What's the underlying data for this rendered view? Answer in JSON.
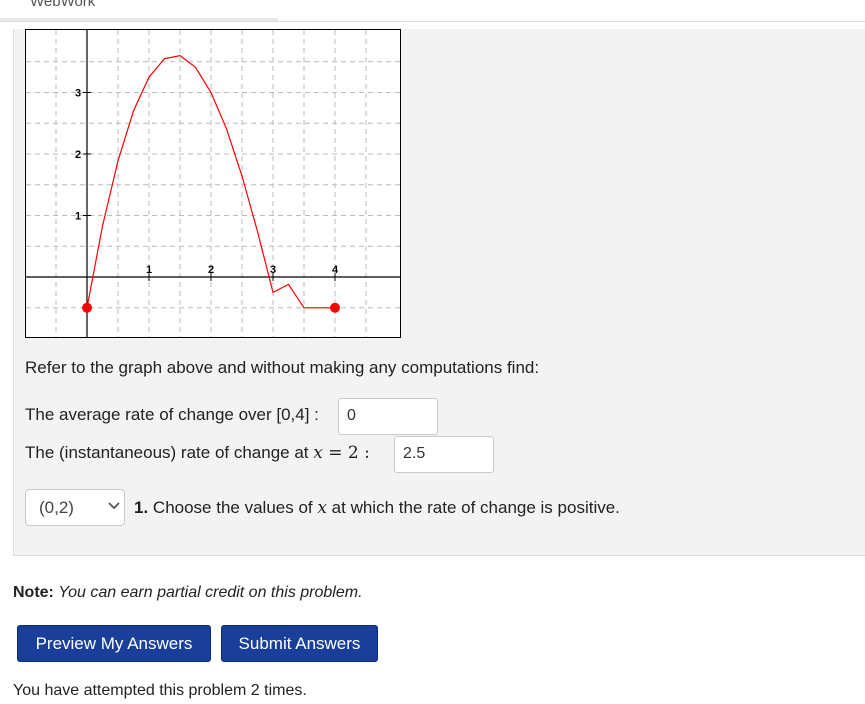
{
  "header": {
    "site_title": "WebWork"
  },
  "graph": {
    "x_tick_labels": [
      "1",
      "2",
      "3",
      "4"
    ],
    "y_tick_labels": [
      "1",
      "2",
      "3"
    ],
    "colors": {
      "curve": "#ff0000",
      "endpoint": "#ff0000",
      "grid": "#bbbbbb",
      "axis": "#000000"
    },
    "chart_data": {
      "type": "line",
      "title": "",
      "xlabel": "",
      "ylabel": "",
      "xlim": [
        -1,
        5
      ],
      "ylim": [
        -1,
        4
      ],
      "grid": true,
      "series": [
        {
          "x": [
            0,
            0.25,
            0.5,
            0.75,
            1,
            1.25,
            1.5,
            1.75,
            2,
            2.25,
            2.5,
            2.75,
            3,
            3.25,
            3.5,
            3.75,
            4
          ],
          "y": [
            -0.5,
            0.83,
            1.89,
            2.7,
            3.25,
            3.55,
            3.6,
            3.41,
            3,
            2.41,
            1.64,
            0.74,
            -0.25,
            -0.12,
            -0.5,
            -0.5,
            -0.5
          ]
        }
      ],
      "endpoints": [
        {
          "x": 0,
          "y": -0.5
        },
        {
          "x": 4,
          "y": -0.5
        }
      ]
    }
  },
  "problem": {
    "instruction": "Refer to the graph above and without making any computations find:",
    "q1_label": "The average rate of change over [0,4] :",
    "q1_answer": "0",
    "q2_label_prefix": "The (instantaneous) rate of change at ",
    "q2_var": "x",
    "q2_eq": " = 2 :",
    "q2_answer": "2.5",
    "select_value": "(0,2)",
    "q3_number": "1.",
    "q3_text_prefix": " Choose the values of ",
    "q3_var": "x",
    "q3_text_suffix": " at which the rate of change is positive."
  },
  "note": {
    "label": "Note:",
    "text": "You can earn partial credit on this problem."
  },
  "buttons": {
    "preview": "Preview My Answers",
    "submit": "Submit Answers"
  },
  "status": {
    "attempts": "You have attempted this problem 2 times."
  }
}
